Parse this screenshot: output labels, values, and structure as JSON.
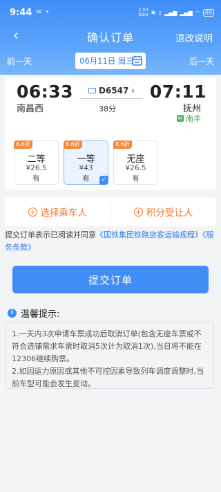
{
  "status_bar": {
    "time": "9:44",
    "net_speed_value": "2.03",
    "net_speed_unit": "KB/s",
    "battery": "89"
  },
  "nav": {
    "back_icon": "‹",
    "title": "确认订单",
    "refund_label": "退改说明"
  },
  "date_bar": {
    "prev_label": "前一天",
    "date": "06月11日 周三",
    "next_label": "后一天"
  },
  "train": {
    "dep_time": "06:33",
    "dep_station": "南昌西",
    "train_no": "D6547",
    "duration": "38分",
    "arr_time": "07:11",
    "arr_station": "抚州",
    "via_badge": "经",
    "via_station": "南丰"
  },
  "seats": [
    {
      "discount": "8.6折",
      "name": "二等",
      "price": "¥26.5",
      "avail": "有",
      "selected": false
    },
    {
      "discount": "8.6折",
      "name": "一等",
      "price": "¥43",
      "avail": "有",
      "selected": true
    },
    {
      "discount": "8.6折",
      "name": "无座",
      "price": "¥26.5",
      "avail": "有",
      "selected": false
    }
  ],
  "actions": {
    "select_passenger": "选择乘车人",
    "points_receiver": "积分受让人"
  },
  "agreement": {
    "prefix": "提交订单表示已阅读并同意",
    "link1": "《国铁集团铁路旅客运输规程》",
    "link2": "《服务条款》"
  },
  "submit_label": "提交订单",
  "tips": {
    "title": "温馨提示:",
    "item1": "1.一天内3次申请车票成功后取消订单(包含无座车票或不符合选铺需求车票时取消5次计为取消1次),当日将不能在12306继续购票。",
    "item2": "2.如因运力原因或其他不可控因素导致列车调度调整时,当前车型可能会发生变动。"
  },
  "colors": {
    "brand_blue": "#3f8ef8",
    "accent_orange": "#f07a2a"
  }
}
